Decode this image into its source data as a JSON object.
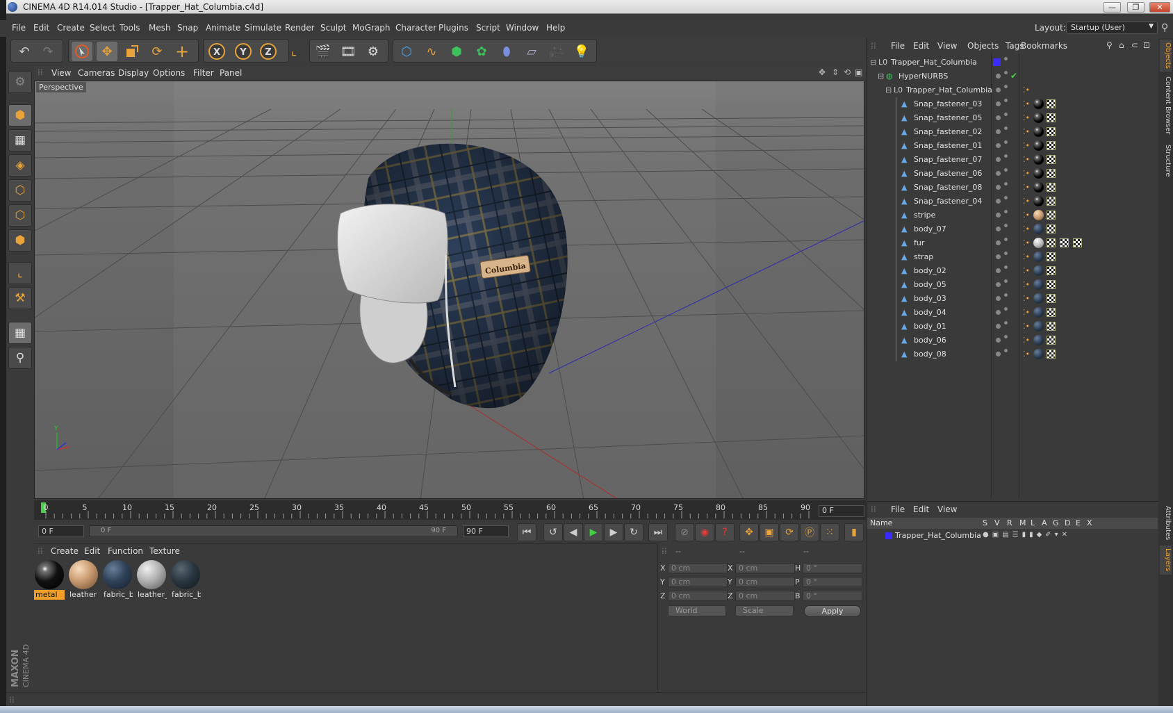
{
  "window": {
    "title": "CINEMA 4D R14.014 Studio - [Trapper_Hat_Columbia.c4d]",
    "buttons": [
      "—",
      "❐",
      "✕"
    ]
  },
  "menubar": {
    "items": [
      "File",
      "Edit",
      "Create",
      "Select",
      "Tools",
      "Mesh",
      "Snap",
      "Animate",
      "Simulate",
      "Render",
      "Sculpt",
      "MoGraph",
      "Character",
      "Plugins",
      "Script",
      "Window",
      "Help"
    ],
    "layout_label": "Layout:",
    "layout_value": "Startup (User)"
  },
  "toolbar": {
    "icons": [
      "undo-icon",
      "redo-icon",
      "live-selection-icon",
      "move-icon",
      "scale-icon",
      "rotate-icon",
      "add-icon",
      "x-axis-icon",
      "y-axis-icon",
      "z-axis-icon",
      "coordinate-system-icon",
      "render-view-icon",
      "render-picture-viewer-icon",
      "render-settings-icon",
      "cube-icon",
      "spline-icon",
      "nurbs-icon",
      "array-icon",
      "deformer-icon",
      "floor-icon",
      "camera-icon",
      "light-icon"
    ],
    "axis_labels": [
      "X",
      "Y",
      "Z"
    ]
  },
  "palette": {
    "icons": [
      "make-editable-icon",
      "model-mode-icon",
      "texture-mode-icon",
      "workplane-mode-icon",
      "points-mode-icon",
      "edges-mode-icon",
      "polygons-mode-icon",
      "axis-mode-icon",
      "tweak-mode-icon",
      "snapping-icon",
      "locked-workplane-icon"
    ]
  },
  "viewport": {
    "menu": [
      "View",
      "Cameras",
      "Display",
      "Options",
      "Filter",
      "Panel"
    ],
    "label": "Perspective",
    "logo_text": "Columbia"
  },
  "timeline": {
    "ticks": [
      "0",
      "5",
      "10",
      "15",
      "20",
      "25",
      "30",
      "35",
      "40",
      "45",
      "50",
      "55",
      "60",
      "65",
      "70",
      "75",
      "80",
      "85",
      "90"
    ],
    "current_frame": "0 F"
  },
  "transport": {
    "start": "0 F",
    "range_start": "0 F",
    "range_end": "90 F",
    "end": "90 F"
  },
  "materials": {
    "menu": [
      "Create",
      "Edit",
      "Function",
      "Texture"
    ],
    "items": [
      {
        "label": "metal",
        "color": "#1a1a1a"
      },
      {
        "label": "leather",
        "color": "#caa07a"
      },
      {
        "label": "fabric_b",
        "color": "#2f4258"
      },
      {
        "label": "leather_",
        "color": "#b0b0b0"
      },
      {
        "label": "fabric_b",
        "color": "#2a3641"
      }
    ]
  },
  "coordinates": {
    "headers": [
      "--",
      "--",
      "--"
    ],
    "rows": [
      {
        "a": "X",
        "av": "0 cm",
        "b": "X",
        "bv": "0 cm",
        "c": "H",
        "cv": "0 °"
      },
      {
        "a": "Y",
        "av": "0 cm",
        "b": "Y",
        "bv": "0 cm",
        "c": "P",
        "cv": "0 °"
      },
      {
        "a": "Z",
        "av": "0 cm",
        "b": "Z",
        "bv": "0 cm",
        "c": "B",
        "cv": "0 °"
      }
    ],
    "space": "World",
    "mode": "Scale",
    "apply": "Apply"
  },
  "objects": {
    "menu": [
      "File",
      "Edit",
      "View",
      "Objects",
      "Tags",
      "Bookmarks"
    ],
    "rows": [
      {
        "name": "Trapper_Hat_Columbia",
        "depth": 0,
        "type": "null",
        "tags": "layer"
      },
      {
        "name": "HyperNURBS",
        "depth": 1,
        "type": "nurbs",
        "tags": "check"
      },
      {
        "name": "Trapper_Hat_Columbia",
        "depth": 2,
        "type": "null",
        "tags": "phong"
      },
      {
        "name": "Snap_fastener_03",
        "depth": 3,
        "type": "poly",
        "tags": "metal"
      },
      {
        "name": "Snap_fastener_05",
        "depth": 3,
        "type": "poly",
        "tags": "metal"
      },
      {
        "name": "Snap_fastener_02",
        "depth": 3,
        "type": "poly",
        "tags": "metal"
      },
      {
        "name": "Snap_fastener_01",
        "depth": 3,
        "type": "poly",
        "tags": "metal"
      },
      {
        "name": "Snap_fastener_07",
        "depth": 3,
        "type": "poly",
        "tags": "metal"
      },
      {
        "name": "Snap_fastener_06",
        "depth": 3,
        "type": "poly",
        "tags": "metal"
      },
      {
        "name": "Snap_fastener_08",
        "depth": 3,
        "type": "poly",
        "tags": "metal"
      },
      {
        "name": "Snap_fastener_04",
        "depth": 3,
        "type": "poly",
        "tags": "metal"
      },
      {
        "name": "stripe",
        "depth": 3,
        "type": "poly",
        "tags": "leather"
      },
      {
        "name": "body_07",
        "depth": 3,
        "type": "poly",
        "tags": "fabric"
      },
      {
        "name": "fur",
        "depth": 3,
        "type": "poly",
        "tags": "fur"
      },
      {
        "name": "strap",
        "depth": 3,
        "type": "poly",
        "tags": "fabric"
      },
      {
        "name": "body_02",
        "depth": 3,
        "type": "poly",
        "tags": "fabric"
      },
      {
        "name": "body_05",
        "depth": 3,
        "type": "poly",
        "tags": "fabric"
      },
      {
        "name": "body_03",
        "depth": 3,
        "type": "poly",
        "tags": "fabric"
      },
      {
        "name": "body_04",
        "depth": 3,
        "type": "poly",
        "tags": "fabric"
      },
      {
        "name": "body_01",
        "depth": 3,
        "type": "poly",
        "tags": "fabric"
      },
      {
        "name": "body_06",
        "depth": 3,
        "type": "poly",
        "tags": "fabric"
      },
      {
        "name": "body_08",
        "depth": 3,
        "type": "poly",
        "tags": "fabric"
      }
    ]
  },
  "layers": {
    "menu": [
      "File",
      "Edit",
      "View"
    ],
    "columns": [
      "Name",
      "S",
      "V",
      "R",
      "M",
      "L",
      "A",
      "G",
      "D",
      "E",
      "X"
    ],
    "row_name": "Trapper_Hat_Columbia"
  },
  "right_tabs": [
    "Objects",
    "Content Browser",
    "Structure",
    "Attributes",
    "Layers"
  ],
  "brand": {
    "maxon": "MAXON",
    "cinema": "CINEMA 4D"
  },
  "colors": {
    "accent": "#f0a02a",
    "layer_blue": "#3a2bff"
  }
}
